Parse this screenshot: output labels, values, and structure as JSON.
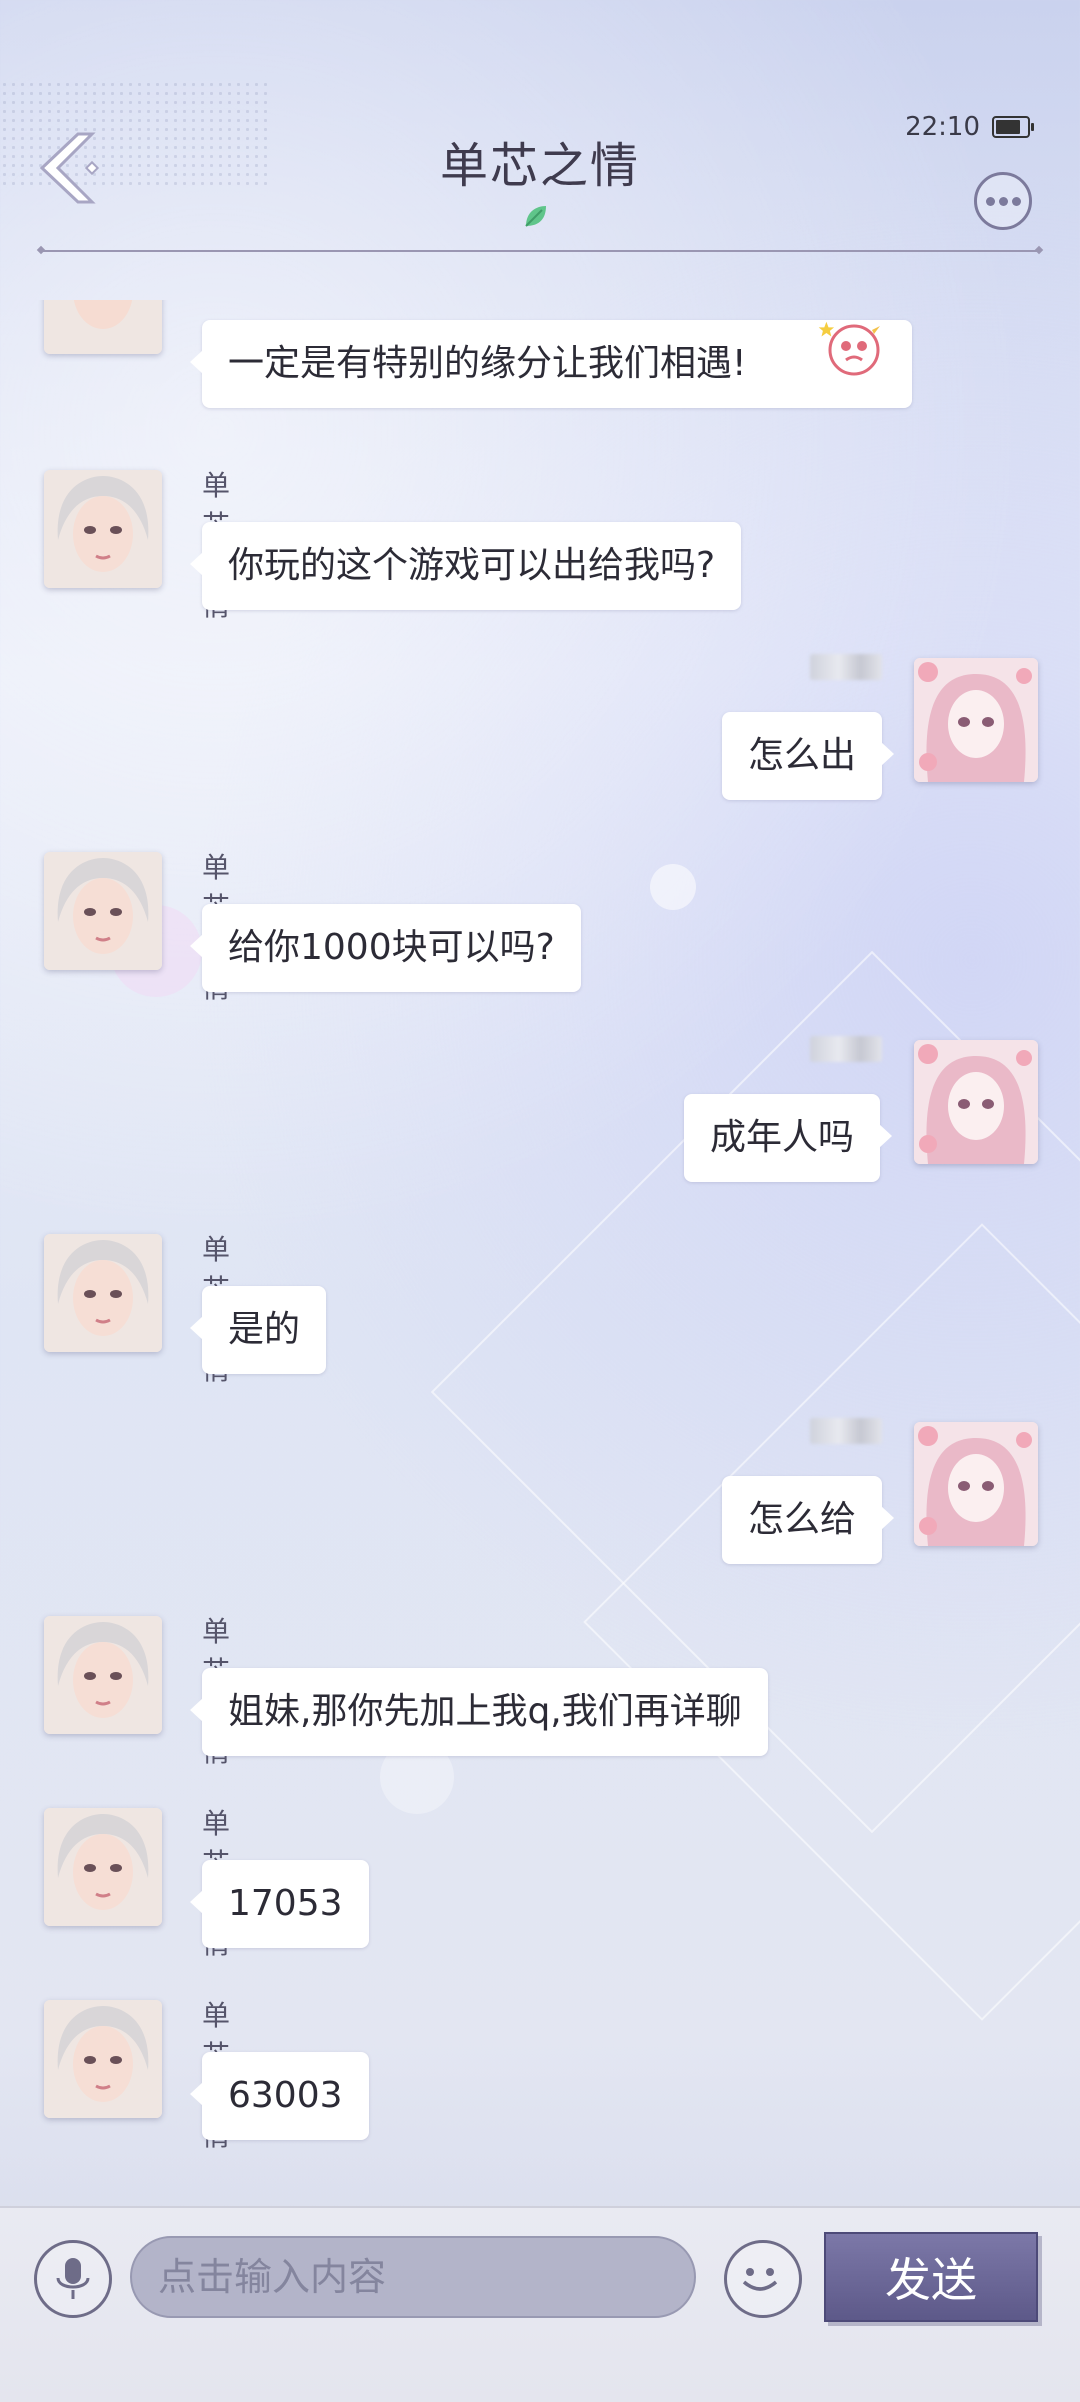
{
  "header": {
    "title": "单芯之情",
    "time": "22:10"
  },
  "messages": [
    {
      "side": "left",
      "sender": "",
      "text": "一定是有特别的缘分让我们相遇!"
    },
    {
      "side": "left",
      "sender": "单芯之情",
      "text": "你玩的这个游戏可以出给我吗?"
    },
    {
      "side": "right",
      "sender": "",
      "text": "怎么出"
    },
    {
      "side": "left",
      "sender": "单芯之情",
      "text": "给你1000块可以吗?"
    },
    {
      "side": "right",
      "sender": "",
      "text": "成年人吗"
    },
    {
      "side": "left",
      "sender": "单芯之情",
      "text": "是的"
    },
    {
      "side": "right",
      "sender": "",
      "text": "怎么给"
    },
    {
      "side": "left",
      "sender": "单芯之情",
      "text": "姐妹,那你先加上我q,我们再详聊"
    },
    {
      "side": "left",
      "sender": "单芯之情",
      "text": "17053"
    },
    {
      "side": "left",
      "sender": "单芯之情",
      "text": "63003"
    }
  ],
  "input": {
    "placeholder": "点击输入内容",
    "value": ""
  },
  "send_button": {
    "label": "发送"
  },
  "icons": {
    "back": "back-arrow-icon",
    "more": "more-options-icon",
    "mic": "microphone-icon",
    "emoji": "emoji-icon",
    "leaf": "leaf-icon"
  }
}
